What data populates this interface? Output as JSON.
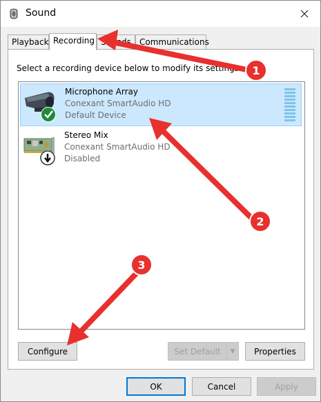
{
  "window": {
    "title": "Sound"
  },
  "tabs": [
    {
      "label": "Playback"
    },
    {
      "label": "Recording"
    },
    {
      "label": "Sounds"
    },
    {
      "label": "Communications"
    }
  ],
  "instruction": "Select a recording device below to modify its settings:",
  "devices": [
    {
      "name": "Microphone Array",
      "driver": "Conexant SmartAudio HD",
      "status": "Default Device",
      "selected": true,
      "icon": "microphone-icon",
      "badge": "check-icon"
    },
    {
      "name": "Stereo Mix",
      "driver": "Conexant SmartAudio HD",
      "status": "Disabled",
      "selected": false,
      "icon": "sound-card-icon",
      "badge": "down-arrow-icon"
    }
  ],
  "buttons": {
    "configure": "Configure",
    "set_default": "Set Default",
    "properties": "Properties",
    "ok": "OK",
    "cancel": "Cancel",
    "apply": "Apply"
  },
  "annotations": [
    {
      "number": "1"
    },
    {
      "number": "2"
    },
    {
      "number": "3"
    }
  ],
  "colors": {
    "selection": "#cce8ff",
    "annotation": "#e8302e",
    "accent": "#0078d7"
  }
}
